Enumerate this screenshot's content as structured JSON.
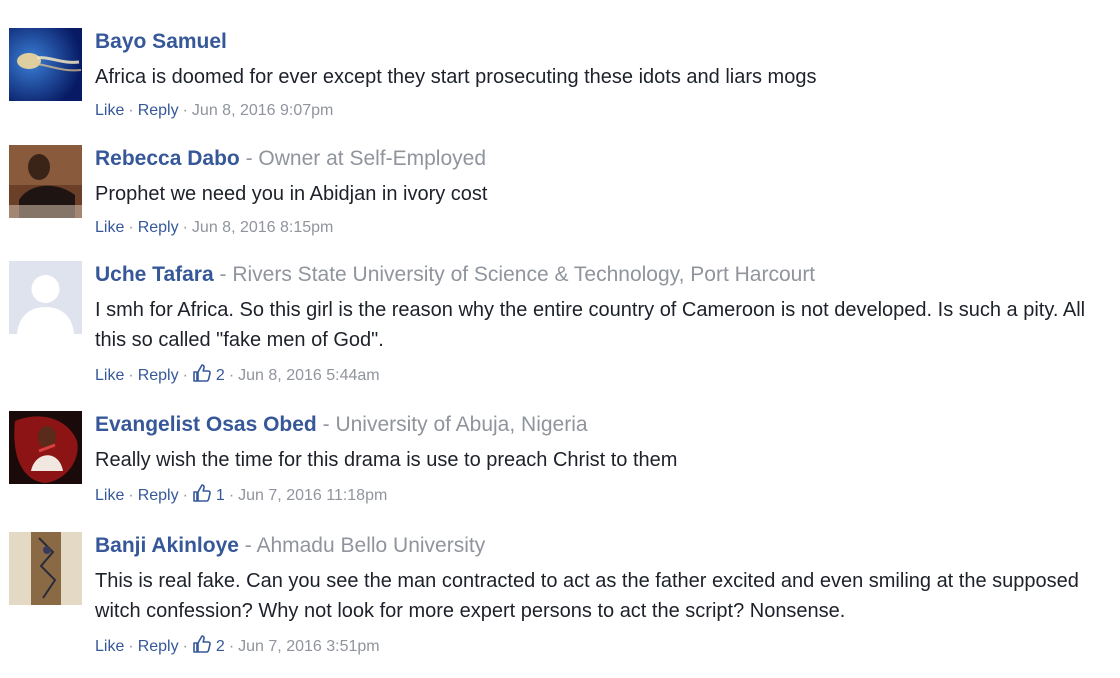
{
  "comments": [
    {
      "author": "Bayo Samuel",
      "affiliation": "",
      "text": "Africa is doomed for ever except they start prosecuting these idots and liars mogs",
      "like_label": "Like",
      "reply_label": "Reply",
      "likes": "",
      "timestamp": "Jun 8, 2016 9:07pm",
      "avatar": "avatar-photo-jellyfish"
    },
    {
      "author": "Rebecca Dabo",
      "affiliation": "Owner at Self-Employed",
      "text": "Prophet we need you in Abidjan in ivory cost",
      "like_label": "Like",
      "reply_label": "Reply",
      "likes": "",
      "timestamp": "Jun 8, 2016 8:15pm",
      "avatar": "avatar-photo-person"
    },
    {
      "author": "Uche Tafara",
      "affiliation": "Rivers State University of Science & Technology, Port Harcourt",
      "text": "I smh for Africa. So this girl is the reason why the entire country of Cameroon is not developed. Is such a pity. All this so called \"fake men of God\".",
      "like_label": "Like",
      "reply_label": "Reply",
      "likes": "2",
      "timestamp": "Jun 8, 2016 5:44am",
      "avatar": "default-avatar-icon"
    },
    {
      "author": "Evangelist Osas Obed",
      "affiliation": "University of Abuja, Nigeria",
      "text": "Really wish the time for this drama is use to preach Christ to them",
      "like_label": "Like",
      "reply_label": "Reply",
      "likes": "1",
      "timestamp": "Jun 7, 2016 11:18pm",
      "avatar": "avatar-photo-red"
    },
    {
      "author": "Banji Akinloye",
      "affiliation": "Ahmadu Bello University",
      "text": "This is real fake. Can you see the man contracted to act as the father excited and even smiling at the supposed witch confession? Why not look for more expert persons to act the script? Nonsense.",
      "like_label": "Like",
      "reply_label": "Reply",
      "likes": "2",
      "timestamp": "Jun 7, 2016 3:51pm",
      "avatar": "avatar-photo-sketch"
    }
  ],
  "colors": {
    "author_link": "#365899",
    "affiliation": "#90949c",
    "body_text": "#1d2129",
    "meta_text": "#90949c"
  }
}
